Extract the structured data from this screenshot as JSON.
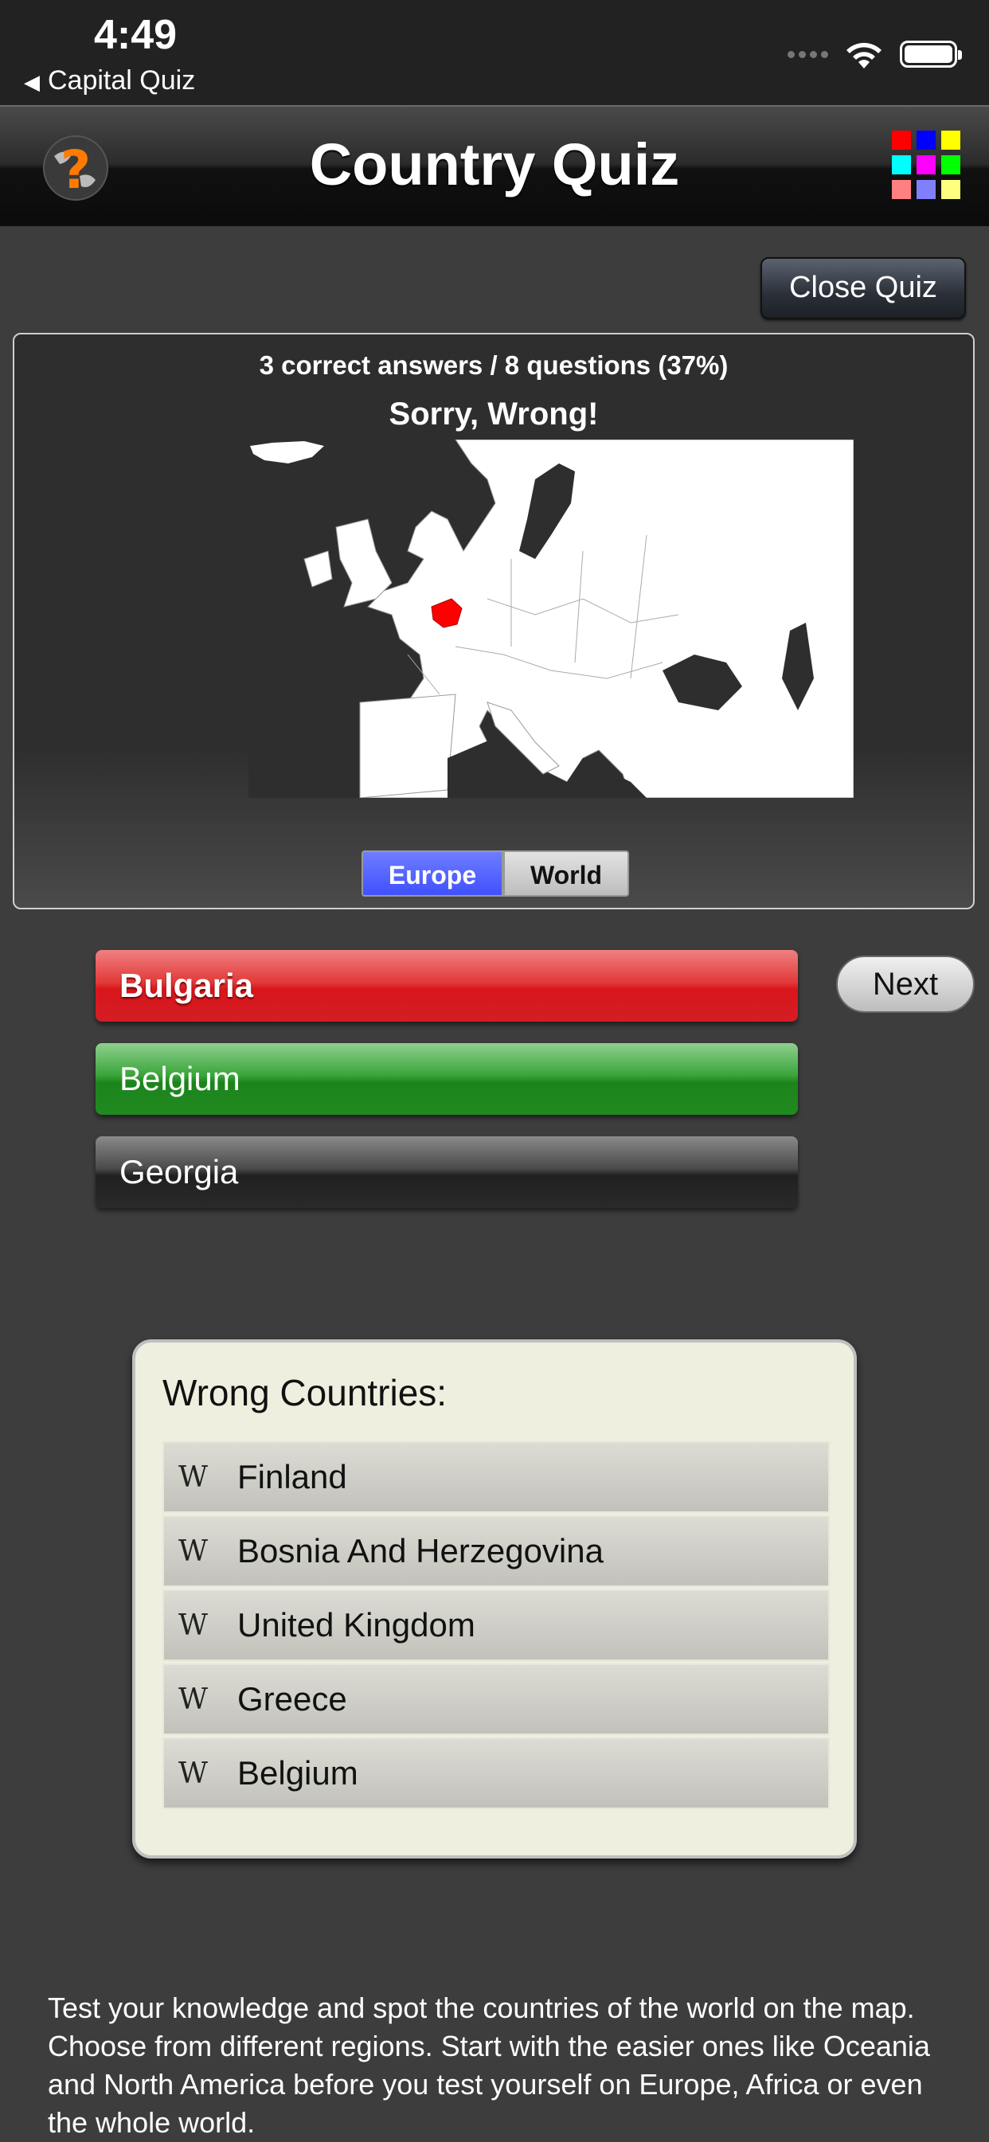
{
  "status": {
    "time": "4:49",
    "back_label": "Capital Quiz"
  },
  "nav": {
    "title": "Country Quiz"
  },
  "close_button": "Close Quiz",
  "quiz": {
    "score": "3 correct answers / 8 questions (37%)",
    "feedback": "Sorry, Wrong!",
    "highlight_color": "#ff0000",
    "regions": [
      {
        "label": "Europe",
        "selected": true
      },
      {
        "label": "World",
        "selected": false
      }
    ]
  },
  "answers": [
    {
      "label": "Bulgaria",
      "state": "wrong",
      "color": "#e02020"
    },
    {
      "label": "Belgium",
      "state": "correct",
      "color": "#2a8f2a"
    },
    {
      "label": "Georgia",
      "state": "neutral",
      "color": "#2a2a2a"
    }
  ],
  "next_label": "Next",
  "wrong_countries": {
    "title": "Wrong Countries:",
    "icon": "W",
    "items": [
      "Finland",
      "Bosnia And Herzegovina",
      "United Kingdom",
      "Greece",
      "Belgium"
    ]
  },
  "description": "Test your knowledge and spot the countries of the world on the map. Choose from different regions. Start with the easier ones like Oceania and North America before you test yourself on Europe, Africa or even the whole world.",
  "grid_colors": [
    "#ff0000",
    "#0000ff",
    "#ffff00",
    "#00ffff",
    "#ff00ff",
    "#00ff00",
    "#ff8080",
    "#8080ff",
    "#ffff80"
  ]
}
